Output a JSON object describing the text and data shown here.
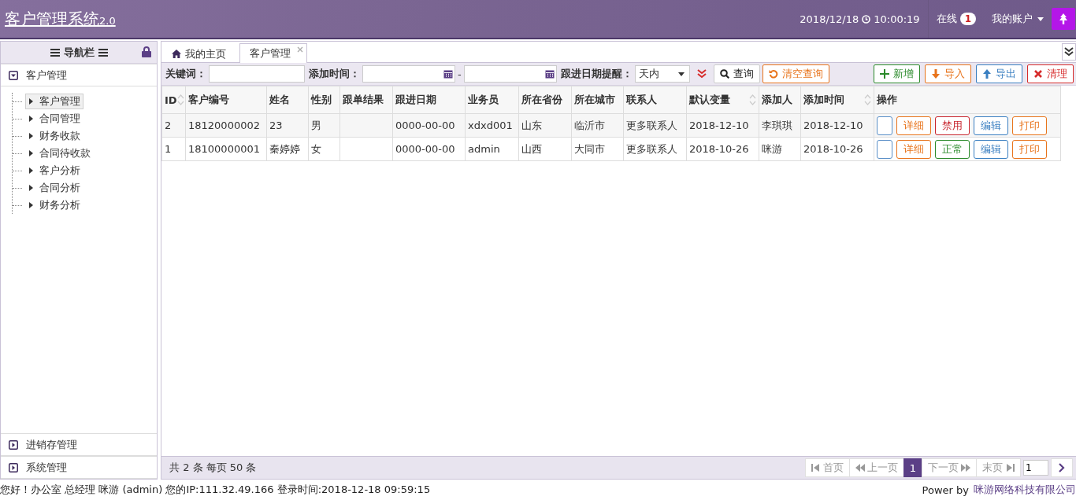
{
  "header": {
    "title": "客户管理系统",
    "version": "2.0",
    "date": "2018/12/18",
    "time": "10:00:19",
    "online_label": "在线",
    "online_count": "1",
    "account": "我的账户"
  },
  "sidebar": {
    "title": "导航栏",
    "sections": [
      {
        "label": "客户管理",
        "expanded": true,
        "children": [
          {
            "label": "客户管理",
            "selected": true
          },
          {
            "label": "合同管理",
            "selected": false
          },
          {
            "label": "财务收款",
            "selected": false
          },
          {
            "label": "合同待收款",
            "selected": false
          },
          {
            "label": "客户分析",
            "selected": false
          },
          {
            "label": "合同分析",
            "selected": false
          },
          {
            "label": "财务分析",
            "selected": false
          }
        ]
      },
      {
        "label": "进销存管理",
        "expanded": false
      },
      {
        "label": "系统管理",
        "expanded": false
      }
    ]
  },
  "tabs": [
    {
      "label": "我的主页",
      "kind": "home",
      "selected": false
    },
    {
      "label": "客户管理",
      "kind": "closable",
      "selected": true
    }
  ],
  "toolbar": {
    "keyword_label": "关键词：",
    "date_label": "添加时间：",
    "date_separator": "-",
    "remind_label": "跟进日期提醒：",
    "remind_value": "天内",
    "search_button": "查询",
    "reset_button": "清空查询",
    "actions": [
      {
        "label": "新增",
        "kind": "add"
      },
      {
        "label": "导入",
        "kind": "import"
      },
      {
        "label": "导出",
        "kind": "export"
      },
      {
        "label": "清理",
        "kind": "clear"
      }
    ]
  },
  "table": {
    "columns": [
      {
        "label": "ID",
        "sortable": true
      },
      {
        "label": "客户编号",
        "sortable": false
      },
      {
        "label": "姓名",
        "sortable": false
      },
      {
        "label": "性别",
        "sortable": false
      },
      {
        "label": "跟单结果",
        "sortable": false
      },
      {
        "label": "跟进日期",
        "sortable": false
      },
      {
        "label": "业务员",
        "sortable": false
      },
      {
        "label": "所在省份",
        "sortable": false
      },
      {
        "label": "所在城市",
        "sortable": false
      },
      {
        "label": "联系人",
        "sortable": false
      },
      {
        "label": "默认变量",
        "sortable": true
      },
      {
        "label": "添加人",
        "sortable": false
      },
      {
        "label": "添加时间",
        "sortable": true
      },
      {
        "label": "操作",
        "sortable": false
      }
    ],
    "rows": [
      {
        "cells": [
          "2",
          "18120000002",
          "23",
          "男",
          "",
          "0000-00-00",
          "xdxd001",
          "山东",
          "临沂市",
          "更多联系人",
          "2018-12-10",
          "李琪琪",
          "2018-12-10"
        ],
        "actions": [
          {
            "kind": "blank"
          },
          {
            "label": "详细",
            "kind": "detail"
          },
          {
            "label": "禁用",
            "kind": "disable"
          },
          {
            "label": "编辑",
            "kind": "edit"
          },
          {
            "label": "打印",
            "kind": "print"
          }
        ]
      },
      {
        "cells": [
          "1",
          "18100000001",
          "秦婷婷",
          "女",
          "",
          "0000-00-00",
          "admin",
          "山西",
          "大同市",
          "更多联系人",
          "2018-10-26",
          "咪游",
          "2018-10-26"
        ],
        "actions": [
          {
            "kind": "blank"
          },
          {
            "label": "详细",
            "kind": "detail"
          },
          {
            "label": "正常",
            "kind": "enable"
          },
          {
            "label": "编辑",
            "kind": "edit"
          },
          {
            "label": "打印",
            "kind": "print"
          }
        ]
      }
    ]
  },
  "footer": {
    "summary": "共 2 条 每页 50 条",
    "pages": [
      {
        "label": "首页",
        "kind": "first",
        "selected": false,
        "disabled": true
      },
      {
        "label": "上一页",
        "kind": "prev",
        "selected": false,
        "disabled": true
      },
      {
        "label": "1",
        "kind": "page",
        "selected": true,
        "disabled": false
      },
      {
        "label": "下一页",
        "kind": "next",
        "selected": false,
        "disabled": true
      },
      {
        "label": "末页",
        "kind": "last",
        "selected": false,
        "disabled": true
      }
    ],
    "page_input": "1"
  },
  "status_bar": {
    "text": "您好！办公室 总经理 咪游 (admin) 您的IP:111.32.49.166 登录时间:2018-12-18 09:59:15",
    "powered_label": "Power by",
    "company": "咪游网络科技有限公司"
  }
}
